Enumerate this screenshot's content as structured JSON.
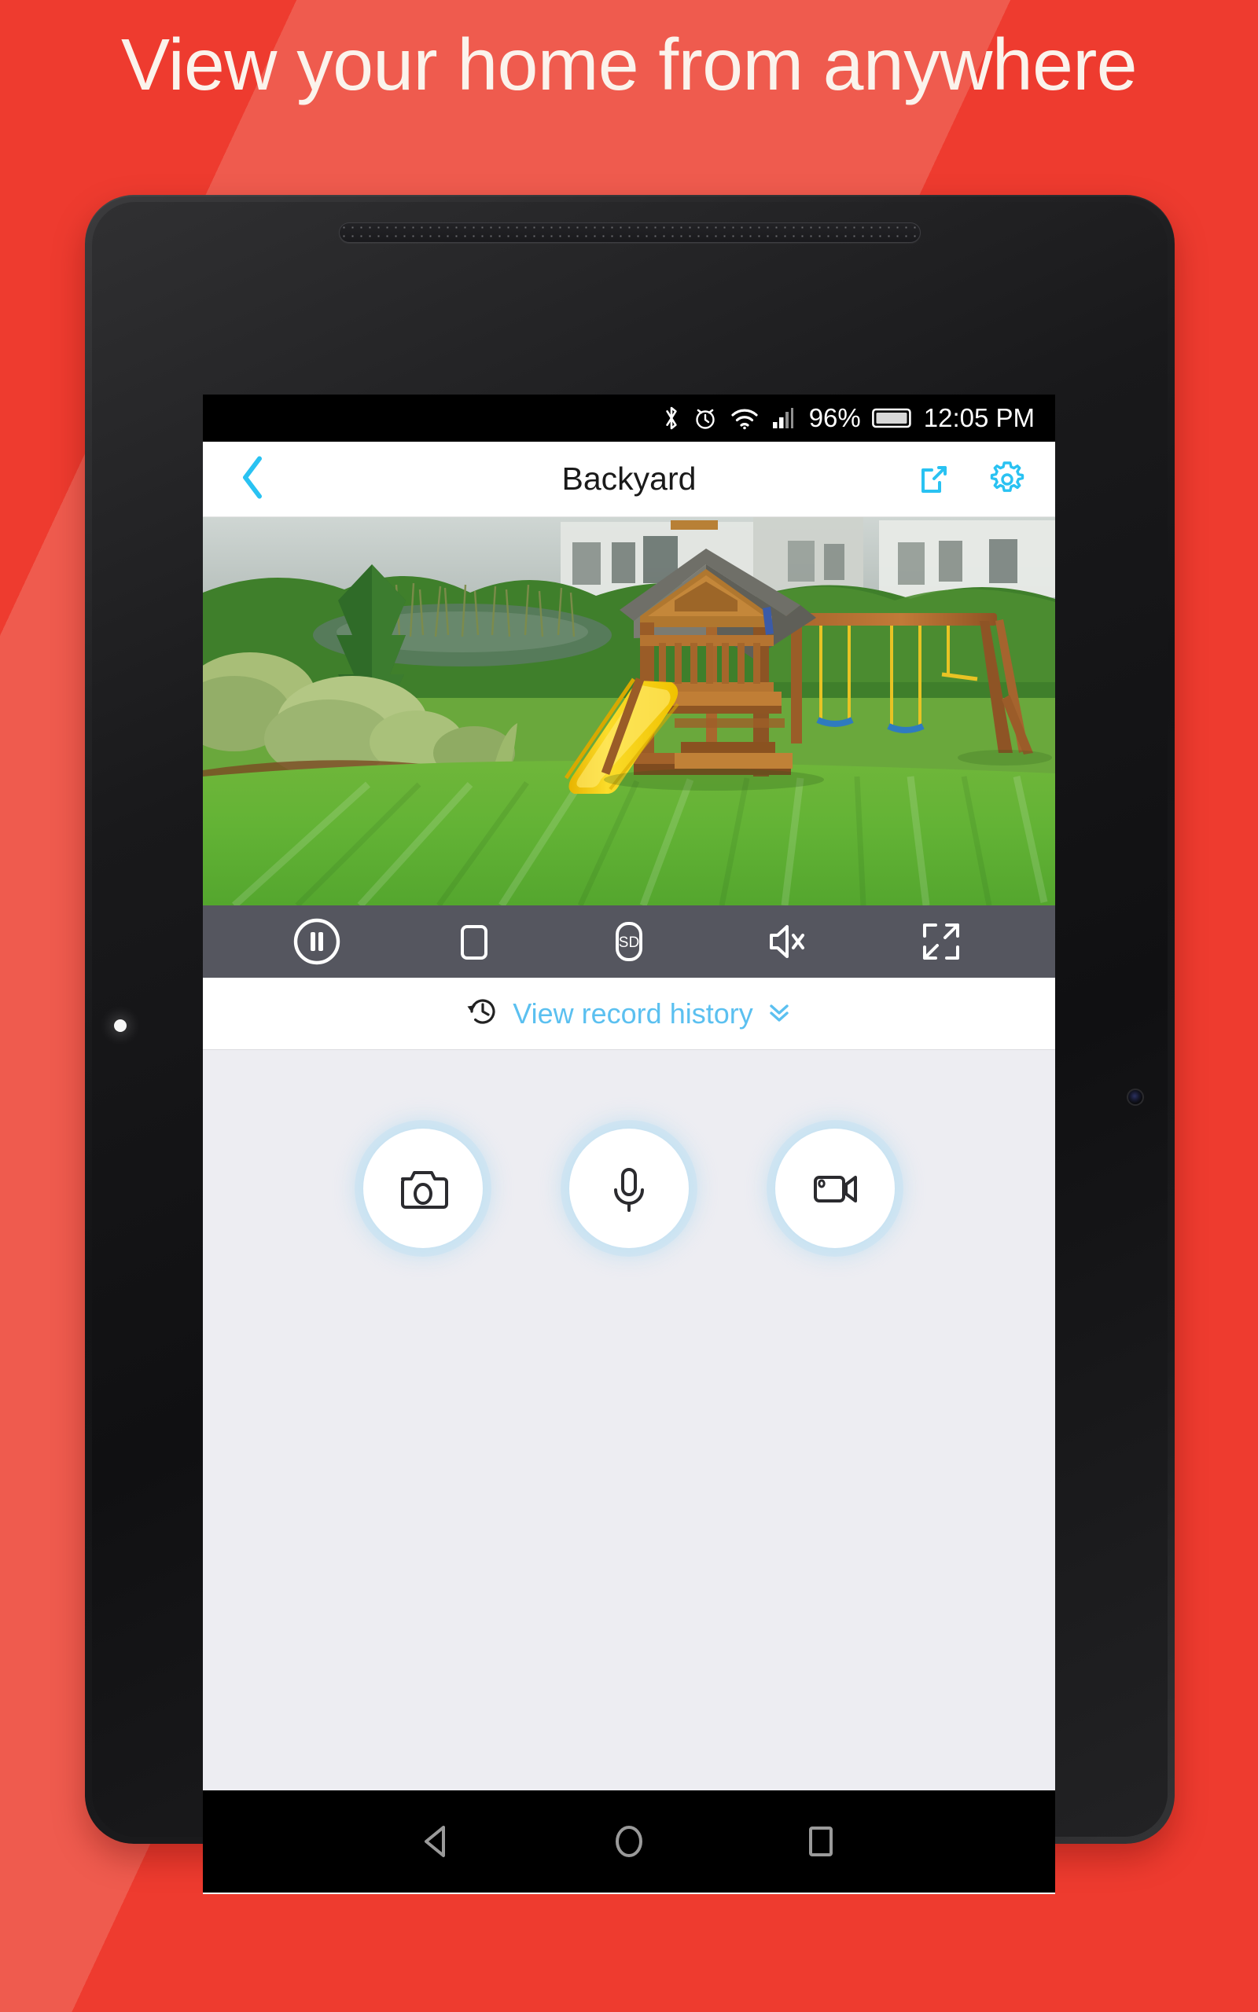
{
  "promo": {
    "headline": "View your home from anywhere",
    "background_color": "#EE3B2F",
    "band_color": "#EF5B4E"
  },
  "device": {
    "kind": "android-tablet",
    "body_color": "#1a1a1c",
    "led_indicator": "white-dot",
    "front_camera": "front-camera-lens",
    "speaker_grilles": 2
  },
  "status_bar": {
    "icons": [
      "bluetooth-icon",
      "alarm-clock-icon",
      "wifi-icon",
      "cellular-signal-icon"
    ],
    "battery_percent": "96%",
    "battery_icon": "battery-full-icon",
    "clock": "12:05 PM"
  },
  "app_header": {
    "back_label": "back-chevron",
    "title": "Backyard",
    "share_label": "share-icon",
    "settings_label": "settings-gear-icon",
    "accent_color": "#29C2F2",
    "title_color": "#1a1a1a"
  },
  "video": {
    "scene": "Backyard camera live view",
    "alt": "Green lawn with wooden playset, yellow slide and swing set, pond and houses in background"
  },
  "controls": {
    "bar_color": "#55565F",
    "items": [
      {
        "name": "pause-button",
        "icon": "pause-circle-icon",
        "label": "Pause"
      },
      {
        "name": "stop-button",
        "icon": "stop-square-icon",
        "label": "Stop"
      },
      {
        "name": "quality-button",
        "icon": "sd-quality-icon",
        "label": "SD"
      },
      {
        "name": "mute-button",
        "icon": "speaker-muted-icon",
        "label": "Muted"
      },
      {
        "name": "fullscreen-button",
        "icon": "expand-icon",
        "label": "Fullscreen"
      }
    ]
  },
  "record_history": {
    "icon": "history-clock-icon",
    "label": "View record history",
    "expand_icon": "double-chevron-down-icon",
    "link_color": "#5BC0F0"
  },
  "actions": {
    "panel_color": "#EDEDF2",
    "items": [
      {
        "name": "snapshot-button",
        "icon": "camera-icon",
        "label": "Snapshot"
      },
      {
        "name": "talk-button",
        "icon": "microphone-icon",
        "label": "Talk"
      },
      {
        "name": "record-button",
        "icon": "video-camera-icon",
        "label": "Record"
      }
    ]
  },
  "nav_bar": {
    "items": [
      {
        "name": "nav-back-button",
        "icon": "triangle-back-icon",
        "label": "Back"
      },
      {
        "name": "nav-home-button",
        "icon": "circle-home-icon",
        "label": "Home"
      },
      {
        "name": "nav-recents-button",
        "icon": "square-recents-icon",
        "label": "Recents"
      }
    ]
  }
}
